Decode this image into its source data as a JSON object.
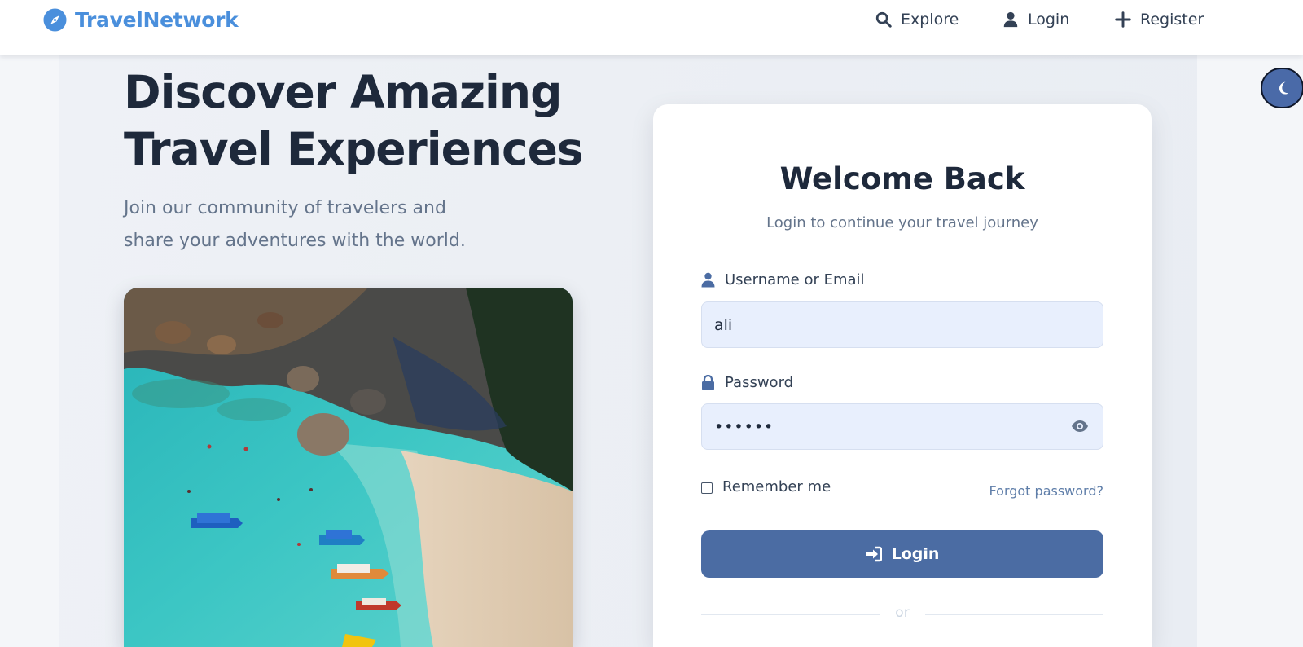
{
  "header": {
    "brand": "TravelNetwork",
    "nav": {
      "explore": "Explore",
      "login": "Login",
      "register": "Register"
    }
  },
  "hero": {
    "title_line1": "Discover Amazing",
    "title_line2": "Travel Experiences",
    "subtitle_line1": "Join our community of travelers and",
    "subtitle_line2": "share your adventures with the world."
  },
  "login_card": {
    "title": "Welcome Back",
    "subtitle": "Login to continue your travel journey",
    "username": {
      "label": "Username or Email",
      "value": "ali"
    },
    "password": {
      "label": "Password",
      "value": "••••••"
    },
    "remember_label": "Remember me",
    "forgot_link": "Forgot password?",
    "submit_label": "Login",
    "divider": "or"
  },
  "colors": {
    "brand": "#4a8fdc",
    "primary_button": "#4b6ca3",
    "input_background": "#e8effd",
    "link": "#5f7ea9"
  },
  "icons": {
    "brand": "compass-icon",
    "explore": "search-icon",
    "login": "user-icon",
    "register": "plus-icon",
    "username_field": "user-icon",
    "password_field": "lock-icon",
    "toggle_password": "eye-icon",
    "submit": "sign-in-icon",
    "theme_toggle": "moon-icon"
  }
}
